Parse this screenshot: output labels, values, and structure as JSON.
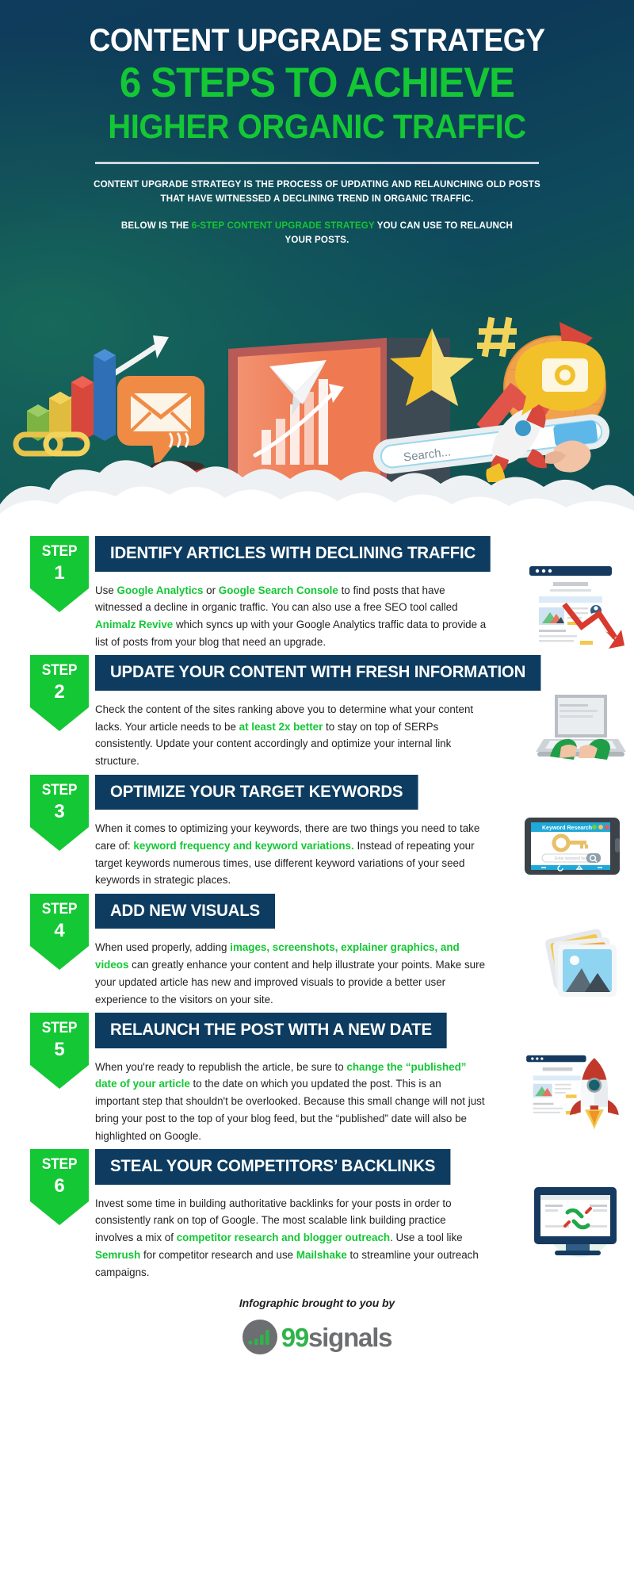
{
  "header": {
    "title_line1": "CONTENT UPGRADE STRATEGY",
    "title_line2": "6 STEPS TO ACHIEVE",
    "title_line3": "HIGHER ORGANIC TRAFFIC",
    "description": "CONTENT UPGRADE STRATEGY IS THE PROCESS OF UPDATING AND RELAUNCHING OLD POSTS THAT HAVE WITNESSED A DECLINING TREND IN ORGANIC TRAFFIC.",
    "sub_pre": "BELOW IS THE ",
    "sub_highlight": "6-STEP CONTENT UPGRADE STRATEGY",
    "sub_post": " YOU CAN USE TO RELAUNCH YOUR POSTS.",
    "hero_search_placeholder": "Search..."
  },
  "colors": {
    "brand_green": "#14c734",
    "navy": "#0d3c60",
    "header_bg_dark": "#0f3c5c",
    "header_bg_teal": "#17695a",
    "body_text": "#231f20",
    "logo_gray": "#6d6e71",
    "logo_green": "#2fb34a"
  },
  "steps": [
    {
      "badge_word": "STEP",
      "badge_number": "1",
      "title": "IDENTIFY ARTICLES WITH DECLINING TRAFFIC",
      "illustration": "browser-declining-chart-icon",
      "body": [
        {
          "t": "Use ",
          "b": false
        },
        {
          "t": "Google Analytics",
          "b": true
        },
        {
          "t": " or ",
          "b": false
        },
        {
          "t": "Google Search Console",
          "b": true
        },
        {
          "t": " to find posts that have witnessed a decline in organic traffic. You can also use a free SEO tool called ",
          "b": false
        },
        {
          "t": "Animalz Revive",
          "b": true
        },
        {
          "t": " which syncs up with your Google Analytics traffic data to provide a list of posts from your blog that need an upgrade.",
          "b": false
        }
      ]
    },
    {
      "badge_word": "STEP",
      "badge_number": "2",
      "title": "UPDATE YOUR CONTENT WITH FRESH INFORMATION",
      "illustration": "laptop-typing-hands-icon",
      "body": [
        {
          "t": "Check the content of the sites ranking above you to determine what your content lacks. Your article needs to be ",
          "b": false
        },
        {
          "t": "at least 2x better",
          "b": true
        },
        {
          "t": " to stay on top of SERPs consistently. Update your content accordingly and optimize your internal link structure.",
          "b": false
        }
      ]
    },
    {
      "badge_word": "STEP",
      "badge_number": "3",
      "title": "OPTIMIZE YOUR TARGET KEYWORDS",
      "illustration": "tablet-keyword-research-icon",
      "illustration_labels": {
        "app_title": "Keyword Research",
        "input_placeholder": "Enter keyword here"
      },
      "body": [
        {
          "t": "When it comes to optimizing your keywords, there are two things you need to take care of: ",
          "b": false
        },
        {
          "t": "keyword frequency and keyword variations.",
          "b": true
        },
        {
          "t": " Instead of repeating your target keywords numerous times, use different keyword variations of your seed keywords in strategic places.",
          "b": false
        }
      ]
    },
    {
      "badge_word": "STEP",
      "badge_number": "4",
      "title": "ADD NEW VISUALS",
      "illustration": "stacked-photos-icon",
      "body": [
        {
          "t": "When used properly, adding ",
          "b": false
        },
        {
          "t": "images, screenshots, explainer graphics, and videos",
          "b": true
        },
        {
          "t": " can greatly enhance your content and help illustrate your points. Make sure your updated article has new and improved visuals to provide a better user experience to the visitors on your site.",
          "b": false
        }
      ]
    },
    {
      "badge_word": "STEP",
      "badge_number": "5",
      "title": "RELAUNCH THE POST WITH A NEW DATE",
      "illustration": "browser-rocket-launch-icon",
      "body": [
        {
          "t": "When you're ready to republish the article, be sure to ",
          "b": false
        },
        {
          "t": "change the “published” date of your article",
          "b": true
        },
        {
          "t": " to the date on which you updated the post. This is an important step that shouldn't be overlooked. Because this small change will not just bring your post to the top of your blog feed, but the “published” date will also be highlighted on Google.",
          "b": false
        }
      ]
    },
    {
      "badge_word": "STEP",
      "badge_number": "6",
      "title": "STEAL YOUR COMPETITORS’ BACKLINKS",
      "illustration": "monitor-broken-link-icon",
      "body": [
        {
          "t": "Invest some time in building authoritative backlinks for your posts in order to consistently rank on top of Google. The most scalable link building practice involves a mix of ",
          "b": false
        },
        {
          "t": "competitor research and blogger outreach",
          "b": true
        },
        {
          "t": ". Use a tool like ",
          "b": false
        },
        {
          "t": "Semrush",
          "b": true
        },
        {
          "t": " for competitor research and use ",
          "b": false
        },
        {
          "t": "Mailshake",
          "b": true
        },
        {
          "t": " to streamline your outreach campaigns.",
          "b": false
        }
      ]
    }
  ],
  "footer": {
    "credit": "Infographic brought to you by",
    "logo_number": "99",
    "logo_word": "signals"
  }
}
